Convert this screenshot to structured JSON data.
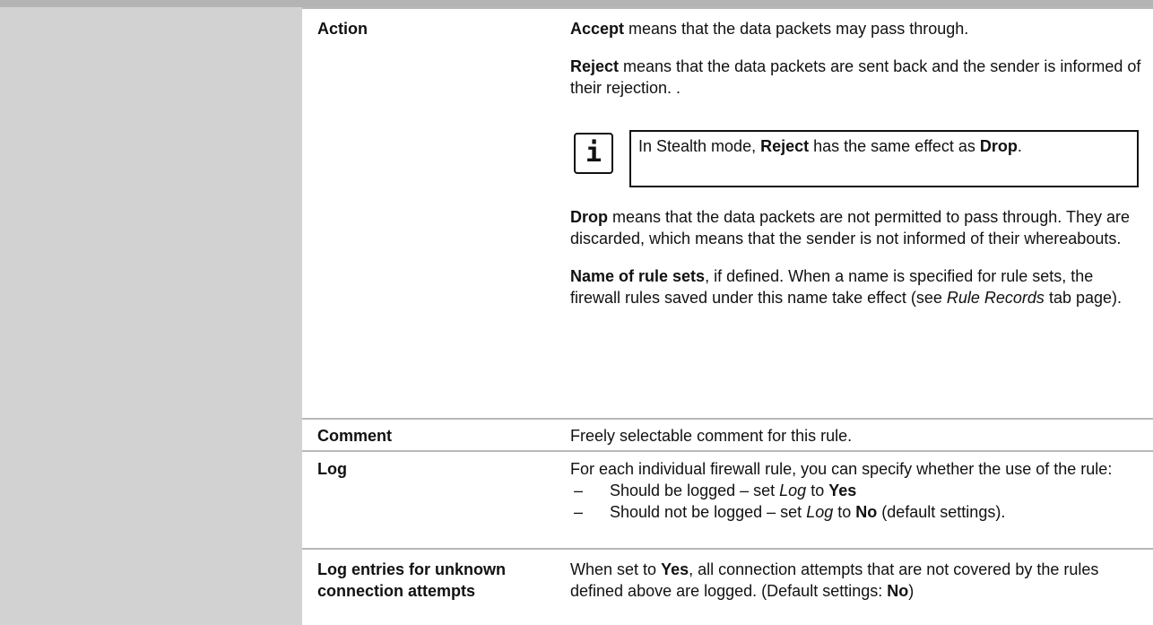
{
  "rows": {
    "action": {
      "term": "Action",
      "accept": {
        "bold": "Accept",
        "text": " means that the data packets may pass through."
      },
      "reject": {
        "bold": "Reject",
        "text": " means that the data packets are sent back and the sender is informed of their rejection. ."
      },
      "note": {
        "pre": "In Stealth mode, ",
        "bold1": "Reject",
        "mid": " has the same effect as ",
        "bold2": "Drop",
        "post": "."
      },
      "drop": {
        "bold": "Drop",
        "text": " means that the data packets are not permitted to pass through. They are discarded, which means that the sender is not informed of their whereabouts."
      },
      "rulesets": {
        "bold": "Name of rule sets",
        "text1": ", if defined. When a name is specified for rule sets, the firewall rules saved under this name take effect (see ",
        "italic": "Rule Records",
        "text2": " tab page)."
      }
    },
    "comment": {
      "term": "Comment",
      "text": "Freely selectable comment for this rule."
    },
    "log": {
      "term": "Log",
      "intro": "For each individual firewall rule, you can specify whether the use of the rule:",
      "bullets": [
        {
          "pre": "Should be logged – set ",
          "italic": "Log",
          "mid": " to ",
          "bold": "Yes",
          "post": ""
        },
        {
          "pre": "Should not be logged – set ",
          "italic": "Log",
          "mid": " to ",
          "bold": "No",
          "post": " (default settings)."
        }
      ]
    },
    "unknown": {
      "term": "Log entries for unknown connection attempts",
      "pre": "When set to ",
      "bold1": "Yes",
      "mid": ", all connection attempts that are not covered by the rules defined above are logged. (Default settings: ",
      "bold2": "No",
      "post": ")"
    }
  }
}
